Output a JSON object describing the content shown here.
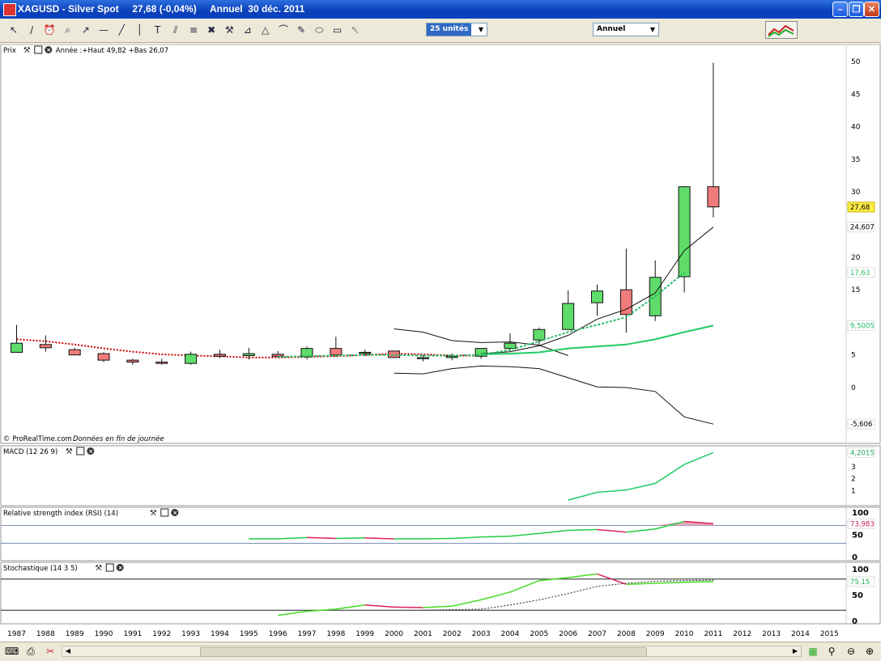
{
  "window": {
    "title": "XAGUSD - Silver Spot     27,68 (-0,04%)     Annuel  30 déc. 2011"
  },
  "toolbar": {
    "units_select": "25 unités",
    "period_select": "Annuel",
    "tools": [
      "pointer-icon",
      "ruler-icon",
      "alarm-icon",
      "zoom-icon",
      "trendline-icon",
      "horizontal-line-icon",
      "line-icon",
      "vertical-line-icon",
      "text-icon",
      "channel-icon",
      "fibonacci-icon",
      "cross-icon",
      "hammer-icon",
      "fan-icon",
      "triangle-icon",
      "arc-icon",
      "pencil-icon",
      "ellipse-icon",
      "rectangle-icon",
      "trash-icon"
    ]
  },
  "panels": {
    "price": {
      "label": "Prix",
      "info": "Année :+Haut 49,82 +Bas 26,07"
    },
    "macd": {
      "label": "MACD (12 26 9)"
    },
    "rsi": {
      "label": "Relative strength index (RSI) (14)"
    },
    "stoch": {
      "label": "Stochastique (14 3 5)"
    }
  },
  "credit": {
    "brand": "© ProRealTime.com",
    "note": "Données en fin de journée"
  },
  "colors": {
    "up": "#5fdc6a",
    "down": "#f07b7b",
    "green_line": "#22cc66",
    "red_dotted": "#cc0000",
    "last_tag": "#ffee44"
  },
  "chart_data": [
    {
      "type": "candlestick",
      "title": "XAGUSD - Silver Spot",
      "ylim": [
        -6.5,
        51
      ],
      "y_ticks": [
        50,
        45,
        40,
        35,
        30,
        20,
        15,
        5,
        0
      ],
      "x": [
        1987,
        1988,
        1989,
        1990,
        1991,
        1992,
        1993,
        1994,
        1995,
        1996,
        1997,
        1998,
        1999,
        2000,
        2001,
        2002,
        2003,
        2004,
        2005,
        2006,
        2007,
        2008,
        2009,
        2010,
        2011
      ],
      "x_ticks": [
        1987,
        1988,
        1989,
        1990,
        1991,
        1992,
        1993,
        1994,
        1995,
        1996,
        1997,
        1998,
        1999,
        2000,
        2001,
        2002,
        2003,
        2004,
        2005,
        2006,
        2007,
        2008,
        2009,
        2010,
        2011,
        2012,
        2013,
        2014,
        2015
      ],
      "open": [
        5.4,
        6.6,
        5.8,
        5.2,
        4.2,
        3.9,
        3.7,
        5.1,
        4.9,
        5.1,
        4.7,
        6.0,
        5.3,
        5.6,
        4.6,
        4.6,
        4.8,
        6.0,
        7.3,
        8.9,
        13.0,
        15.0,
        11.0,
        17.0,
        30.8
      ],
      "high": [
        9.6,
        8.0,
        6.1,
        5.4,
        4.4,
        4.4,
        5.5,
        5.8,
        6.1,
        5.6,
        6.3,
        7.8,
        5.8,
        5.6,
        5.0,
        5.2,
        6.0,
        8.3,
        9.2,
        14.9,
        15.8,
        21.3,
        19.5,
        30.9,
        49.8
      ],
      "low": [
        5.4,
        5.5,
        5.0,
        3.9,
        3.5,
        3.5,
        3.5,
        4.5,
        4.3,
        4.6,
        4.3,
        4.7,
        4.8,
        4.6,
        4.0,
        4.2,
        4.4,
        5.6,
        6.4,
        8.8,
        11.0,
        8.4,
        10.2,
        14.6,
        26.1
      ],
      "close": [
        6.8,
        6.1,
        5.0,
        4.2,
        3.9,
        3.7,
        5.1,
        4.8,
        5.2,
        4.8,
        6.0,
        5.0,
        5.4,
        4.6,
        4.6,
        4.8,
        6.0,
        6.8,
        8.9,
        12.9,
        14.8,
        11.2,
        16.9,
        30.8,
        27.7
      ],
      "overlays": [
        {
          "kind": "moving-average",
          "style": "black-solid",
          "start": 2003,
          "values": [
            5.2,
            5.5,
            6.4,
            8.0,
            10.5,
            12.0,
            14.5,
            21.0,
            24.607
          ]
        },
        {
          "kind": "moving-average",
          "style": "red-dotted",
          "start": 1987,
          "values": [
            7.4,
            7.1,
            6.6,
            6.0,
            5.5,
            5.1,
            4.9,
            4.8,
            4.6,
            4.6,
            4.7,
            4.8,
            5.0,
            5.2,
            5.1,
            4.9,
            4.9
          ]
        },
        {
          "kind": "moving-average",
          "style": "green-dotted",
          "start": 1996,
          "values": [
            4.7,
            4.8,
            4.9,
            5.0,
            5.0,
            4.9,
            4.9,
            5.0,
            5.8,
            7.1,
            8.5,
            9.6,
            10.8,
            14.0,
            17.63
          ]
        },
        {
          "kind": "moving-average",
          "style": "green-solid",
          "start": 2003,
          "values": [
            5.1,
            5.2,
            5.4,
            6.0,
            6.3,
            6.6,
            7.4,
            8.5,
            9.5005
          ]
        },
        {
          "kind": "band",
          "style": "black-solid",
          "start": 2000,
          "values": [
            9.0,
            8.5,
            7.2,
            6.9,
            7.0,
            6.5,
            4.9
          ]
        },
        {
          "kind": "band",
          "style": "black-solid",
          "start": 2000,
          "values": [
            2.2,
            2.1,
            2.9,
            3.3,
            3.2,
            2.9,
            1.5,
            0.1,
            0.0,
            -0.6,
            -4.5,
            -5.606
          ]
        }
      ],
      "last_labels": {
        "close": "27,68",
        "ma1": "24,607",
        "ma2": "17,63",
        "ma3": "9,5005",
        "band_low": "-5,606"
      }
    },
    {
      "type": "line",
      "title": "MACD (12 26 9)",
      "ylim": [
        0,
        4.5
      ],
      "y_ticks": [
        3,
        2,
        1
      ],
      "x": [
        2006,
        2007,
        2008,
        2009,
        2010,
        2011
      ],
      "values": [
        0.2,
        0.85,
        1.05,
        1.6,
        3.2,
        4.2015
      ],
      "last_label": "4,2015"
    },
    {
      "type": "line",
      "title": "Relative strength index (RSI) (14)",
      "ylim": [
        0,
        100
      ],
      "y_ticks": [
        100,
        50,
        0
      ],
      "x": [
        1995,
        1996,
        1997,
        1998,
        1999,
        2000,
        2001,
        2002,
        2003,
        2004,
        2005,
        2006,
        2007,
        2008,
        2009,
        2010,
        2011
      ],
      "values": [
        40,
        40,
        43,
        41,
        42,
        40,
        40,
        41,
        44,
        46,
        52,
        59,
        61,
        55,
        62,
        79,
        73.983
      ],
      "levels": [
        70,
        30
      ],
      "last_label": "73,983"
    },
    {
      "type": "line",
      "title": "Stochastique (14 3 5)",
      "ylim": [
        0,
        100
      ],
      "y_ticks": [
        100,
        50,
        0
      ],
      "levels": [
        80,
        20
      ],
      "x": [
        1996,
        1997,
        1998,
        1999,
        2000,
        2001,
        2002,
        2003,
        2004,
        2005,
        2006,
        2007,
        2008,
        2009,
        2010,
        2011
      ],
      "series": [
        {
          "style": "k",
          "values": [
            10,
            18,
            22,
            30,
            26,
            25,
            28,
            40,
            55,
            77,
            83,
            90,
            70,
            72,
            74,
            75.15
          ]
        },
        {
          "style": "d",
          "values": [
            null,
            null,
            null,
            null,
            null,
            20,
            21,
            22,
            30,
            40,
            52,
            66,
            72,
            76,
            77,
            78
          ]
        }
      ],
      "last_label": "75,15"
    }
  ]
}
